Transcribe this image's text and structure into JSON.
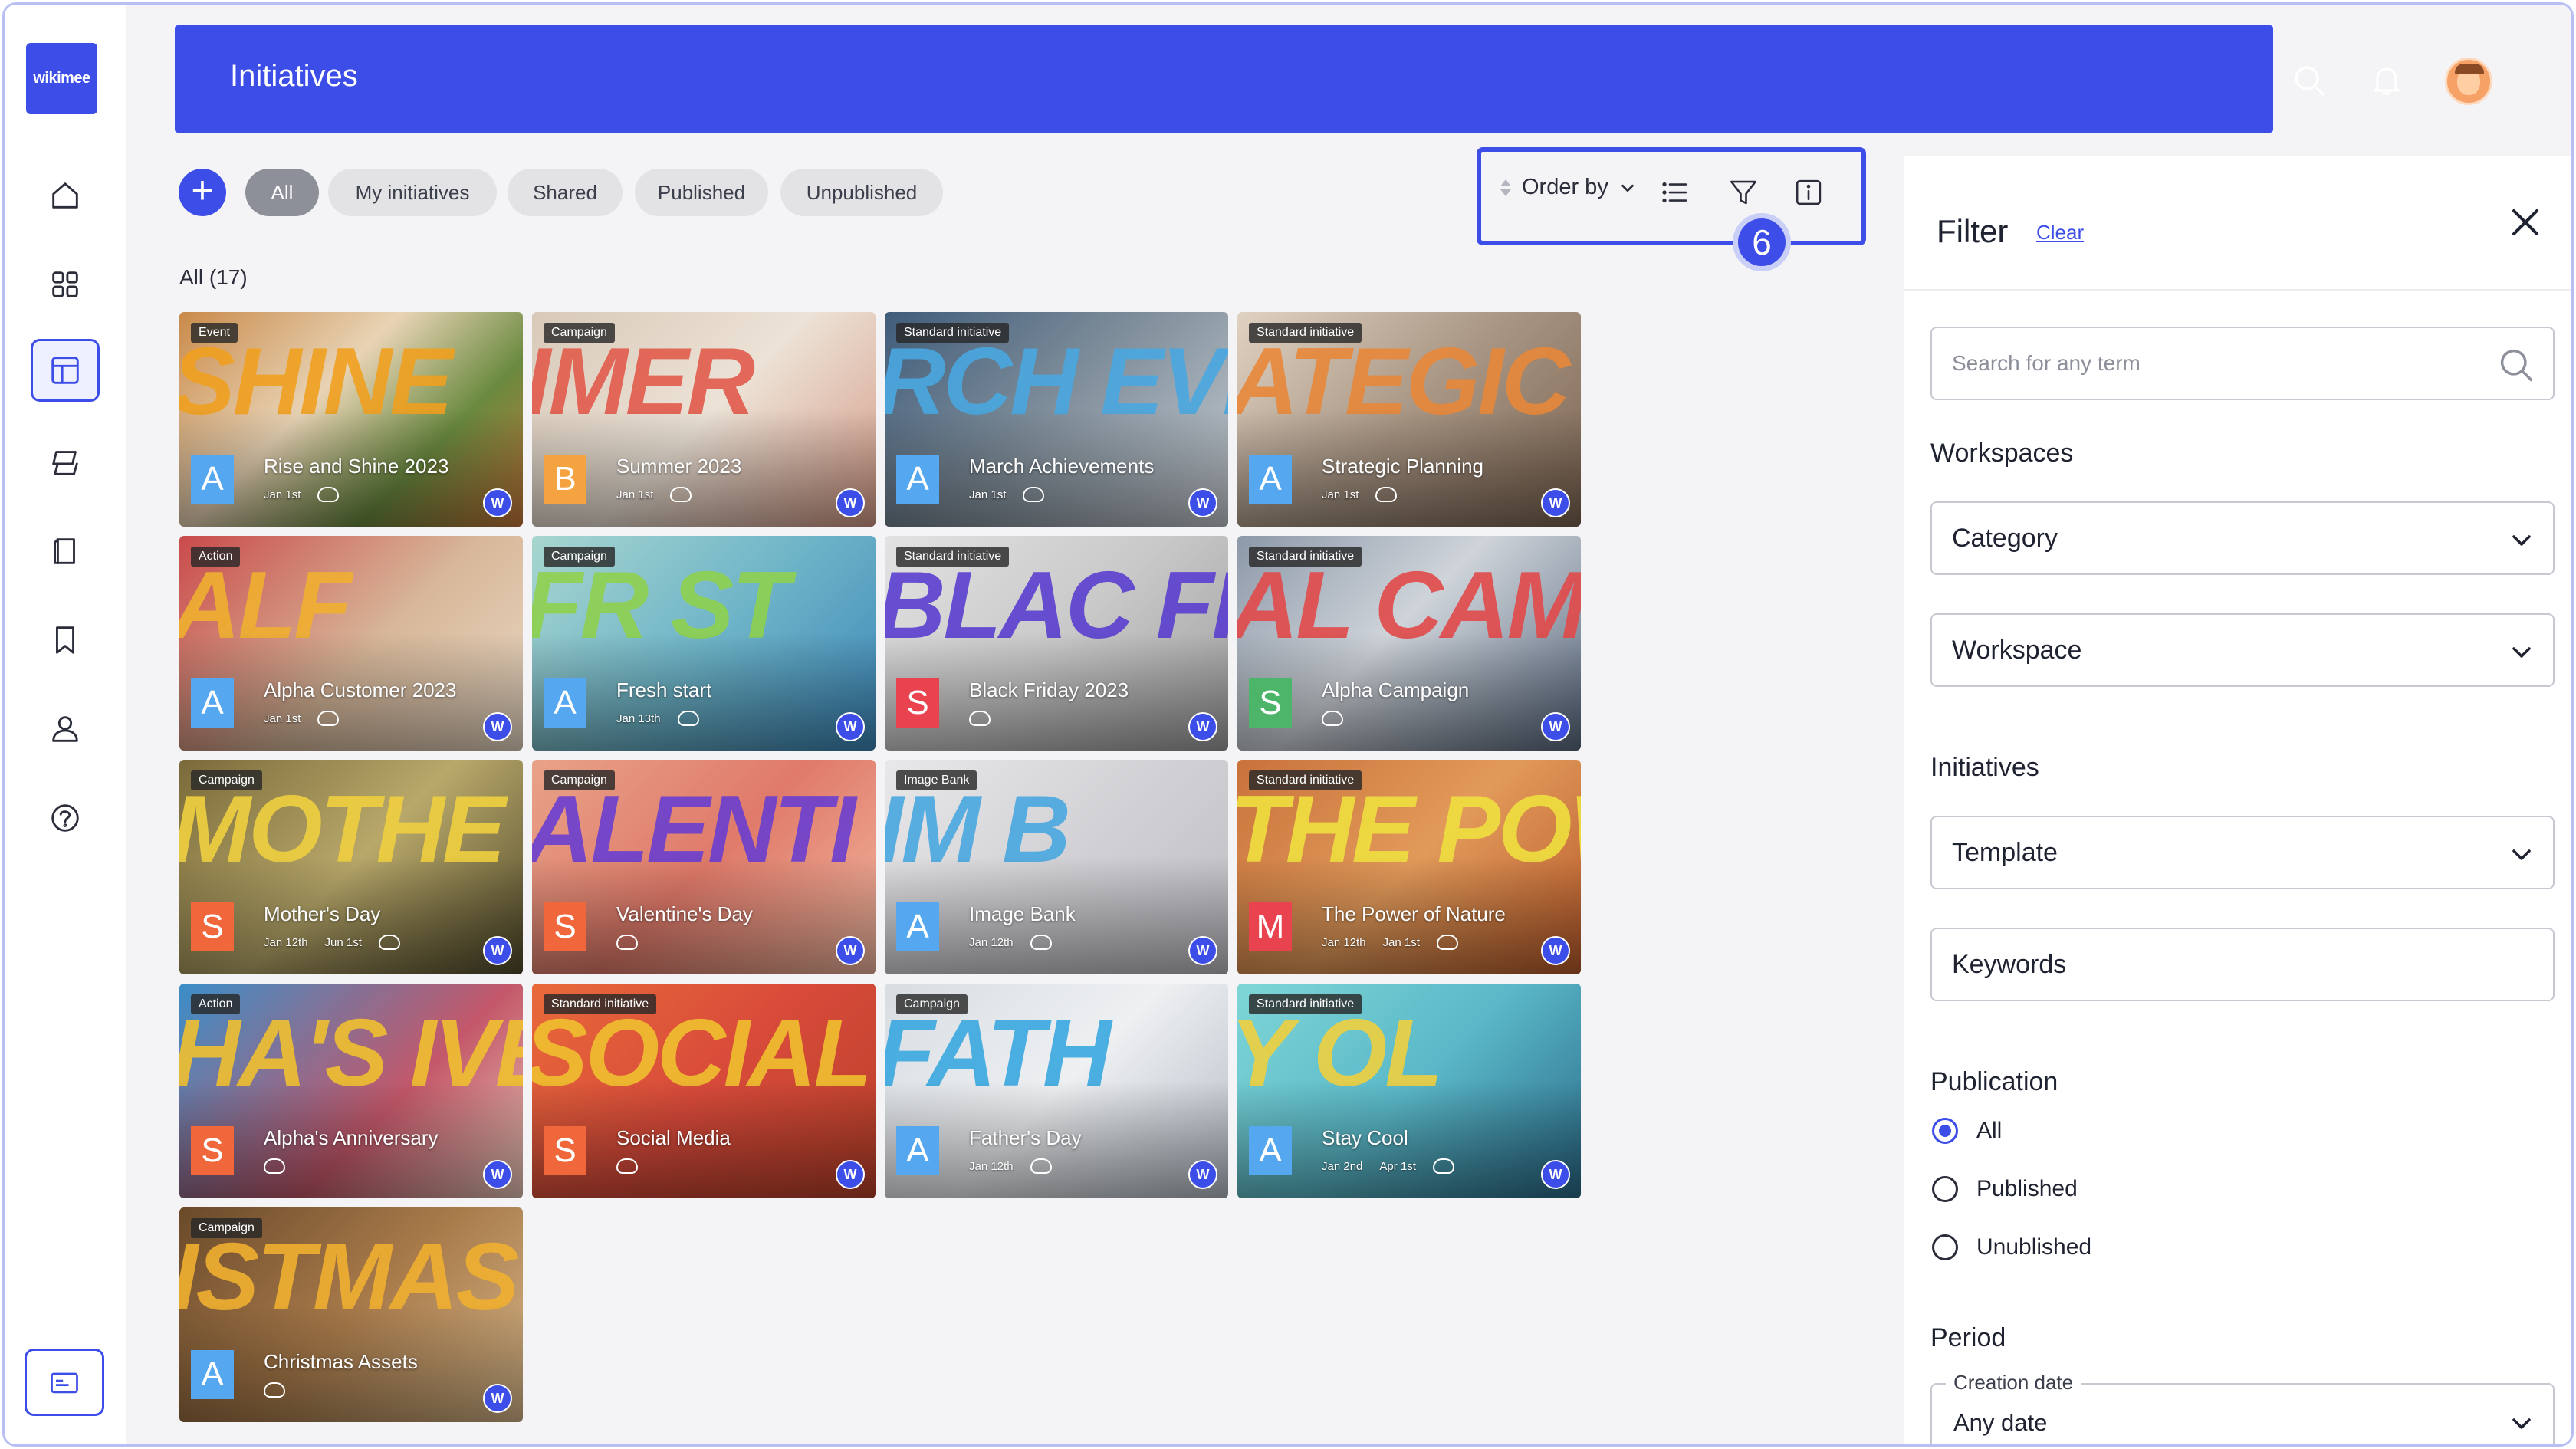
{
  "app": {
    "logo_text": "wikimee",
    "brand_color": "#3d4ee8"
  },
  "header": {
    "title": "Initiatives"
  },
  "rail": {
    "items": [
      "home-icon",
      "apps-icon",
      "initiatives-icon",
      "layers-icon",
      "book-icon",
      "bookmark-icon",
      "user-icon",
      "help-icon"
    ],
    "active": "initiatives-icon",
    "bottom": "card-icon"
  },
  "toolbar": {
    "add_label": "+",
    "chips": [
      "All",
      "My initiatives",
      "Shared",
      "Published",
      "Unpublished"
    ],
    "active_chip": "All",
    "count_label": "All  (17)",
    "order_by": "Order by",
    "step_badge": "6"
  },
  "cards": [
    {
      "type": "Event",
      "letter": "A",
      "letter_color": "#55a8f0",
      "name": "Rise and Shine 2023",
      "date": "Jan 1st",
      "date2": "",
      "big": "SHINE",
      "bg": "linear-gradient(135deg,#c98a4a 0%,#e8d3b5 40%,#6a8a3f 70%,#c9783a 100%)",
      "big_color": "#f0a020"
    },
    {
      "type": "Campaign",
      "letter": "B",
      "letter_color": "#f4a340",
      "name": "Summer 2023",
      "date": "Jan 1st",
      "date2": "",
      "big": "IMER",
      "bg": "linear-gradient(135deg,#d8c9b8 0%,#ece2d6 50%,#d49a86 100%)",
      "big_color": "#e25b4c"
    },
    {
      "type": "Standard initiative",
      "letter": "A",
      "letter_color": "#55a8f0",
      "name": "March Achievements",
      "date": "Jan 1st",
      "date2": "",
      "big": "RCH EVEME",
      "bg": "linear-gradient(135deg,#3f5c7a 0%,#7d8c99 45%,#c6ccd2 100%)",
      "big_color": "#4aa8e0"
    },
    {
      "type": "Standard initiative",
      "letter": "A",
      "letter_color": "#55a8f0",
      "name": "Strategic Planning",
      "date": "Jan 1st",
      "date2": "",
      "big": "ATEGIC",
      "bg": "linear-gradient(135deg,#e0d2c2 0%,#a89583 50%,#7a6350 100%)",
      "big_color": "#e8883a"
    },
    {
      "type": "Action",
      "letter": "A",
      "letter_color": "#55a8f0",
      "name": "Alpha Customer 2023",
      "date": "Jan 1st",
      "date2": "",
      "big": "ALF",
      "bg": "linear-gradient(135deg,#c94a4a 0%,#d8b89a 55%,#e9d9c4 100%)",
      "big_color": "#f0b030"
    },
    {
      "type": "Campaign",
      "letter": "A",
      "letter_color": "#55a8f0",
      "name": "Fresh start",
      "date": "Jan 13th",
      "date2": "",
      "big": "FR ST",
      "bg": "linear-gradient(135deg,#a8d6cf 0%,#6fb5c8 50%,#3c86b8 100%)",
      "big_color": "#8fd14f"
    },
    {
      "type": "Standard initiative",
      "letter": "S",
      "letter_color": "#e8434e",
      "name": "Black Friday 2023",
      "date": "",
      "date2": "",
      "big": "BLAC FRIDA",
      "bg": "linear-gradient(135deg,#e2e2e2 0%,#c9c9c9 50%,#9e9e9e 100%)",
      "big_color": "#5b3fd0"
    },
    {
      "type": "Standard initiative",
      "letter": "S",
      "letter_color": "#4db56a",
      "name": "Alpha Campaign",
      "date": "",
      "date2": "",
      "big": "AL CAMP",
      "bg": "linear-gradient(135deg,#8c98a8 0%,#cfd4da 45%,#5a6a80 100%)",
      "big_color": "#e24a4a"
    },
    {
      "type": "Campaign",
      "letter": "S",
      "letter_color": "#f0673c",
      "name": "Mother's Day",
      "date": "Jan 12th",
      "date2": "Jun 1st",
      "big": "MOTHE",
      "bg": "linear-gradient(135deg,#7a6a3a 0%,#b8a86a 50%,#50492a 100%)",
      "big_color": "#f0d040"
    },
    {
      "type": "Campaign",
      "letter": "S",
      "letter_color": "#f0673c",
      "name": "Valentine's Day",
      "date": "",
      "date2": "",
      "big": "ALENTI",
      "bg": "linear-gradient(135deg,#e8a288 0%,#e07a6a 50%,#f2b8a0 100%)",
      "big_color": "#6a3fd0"
    },
    {
      "type": "Image Bank",
      "letter": "A",
      "letter_color": "#55a8f0",
      "name": "Image Bank",
      "date": "Jan 12th",
      "date2": "",
      "big": "IM B",
      "bg": "linear-gradient(135deg,#e8e8ea 0%,#d2d2d6 50%,#bcbcc2 100%)",
      "big_color": "#4aa8e0"
    },
    {
      "type": "Standard initiative",
      "letter": "M",
      "letter_color": "#e8434e",
      "name": "The Power of Nature",
      "date": "Jan 12th",
      "date2": "Jan 1st",
      "big": "THE POWE",
      "bg": "linear-gradient(135deg,#c9723a 0%,#e29a5a 50%,#b85a2a 100%)",
      "big_color": "#f0e040"
    },
    {
      "type": "Action",
      "letter": "S",
      "letter_color": "#f0673c",
      "name": "Alpha's Anniversary",
      "date": "",
      "date2": "",
      "big": "HA'S IVERSARY",
      "bg": "linear-gradient(135deg,#3a8ec8 0%,#c4586a 60%,#e8c8b8 100%)",
      "big_color": "#f0c030"
    },
    {
      "type": "Standard initiative",
      "letter": "S",
      "letter_color": "#f0673c",
      "name": "Social Media",
      "date": "",
      "date2": "",
      "big": "SOCIAL MEDIA",
      "bg": "linear-gradient(135deg,#e86a3a 0%,#d84a3a 50%,#b8402a 100%)",
      "big_color": "#f0c030"
    },
    {
      "type": "Campaign",
      "letter": "A",
      "letter_color": "#55a8f0",
      "name": "Father's Day",
      "date": "Jan 12th",
      "date2": "",
      "big": "FATH",
      "bg": "linear-gradient(135deg,#d8dde2 0%,#eef0f2 50%,#b4bcc6 100%)",
      "big_color": "#3aa8e0"
    },
    {
      "type": "Standard initiative",
      "letter": "A",
      "letter_color": "#55a8f0",
      "name": "Stay Cool",
      "date": "Jan 2nd",
      "date2": "Apr 1st",
      "big": "Y OL",
      "bg": "linear-gradient(135deg,#7ed6d6 0%,#5ab8c8 50%,#2a6a88 100%)",
      "big_color": "#f0d040"
    },
    {
      "type": "Campaign",
      "letter": "A",
      "letter_color": "#55a8f0",
      "name": "Christmas Assets",
      "date": "",
      "date2": "",
      "big": "ISTMAS",
      "bg": "linear-gradient(135deg,#6a4a2a 0%,#a87a4a 50%,#d8b88a 100%)",
      "big_color": "#f0b030"
    }
  ],
  "filter": {
    "title": "Filter",
    "clear": "Clear",
    "search_placeholder": "Search for any term",
    "workspaces_title": "Workspaces",
    "category": "Category",
    "workspace": "Workspace",
    "initiatives_title": "Initiatives",
    "template": "Template",
    "keywords": "Keywords",
    "publication_title": "Publication",
    "publication_options": [
      "All",
      "Published",
      "Unublished"
    ],
    "publication_selected": "All",
    "period_title": "Period",
    "creation_date_label": "Creation date",
    "creation_date_value": "Any date"
  }
}
